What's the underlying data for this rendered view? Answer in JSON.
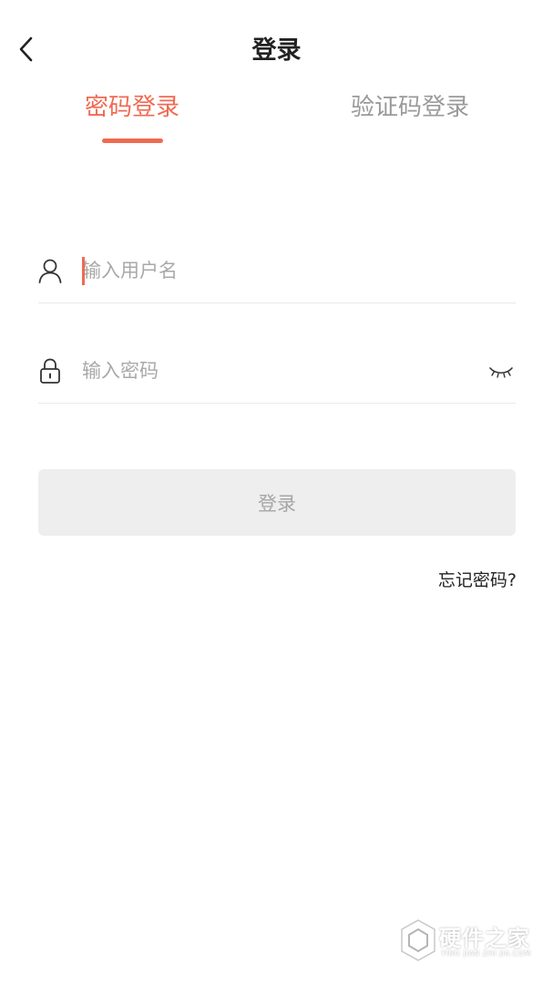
{
  "header": {
    "back_icon": "chevron-left-icon",
    "title": "登录"
  },
  "tabs": [
    {
      "label": "密码登录",
      "active": true
    },
    {
      "label": "验证码登录",
      "active": false
    }
  ],
  "colors": {
    "accent": "#f06a52",
    "muted_text": "#9a9a9a",
    "button_bg": "#eeeeee",
    "button_text": "#a6a6a6"
  },
  "form": {
    "username": {
      "icon": "user-icon",
      "value": "",
      "placeholder": "输入用户名"
    },
    "password": {
      "icon": "lock-icon",
      "value": "",
      "placeholder": "输入密码",
      "toggle_icon": "eye-closed-icon"
    },
    "submit_label": "登录",
    "forgot_label": "忘记密码?"
  },
  "watermark": {
    "text": "硬件之家",
    "sub": "YING JIAN ZHI JIA.COM"
  }
}
